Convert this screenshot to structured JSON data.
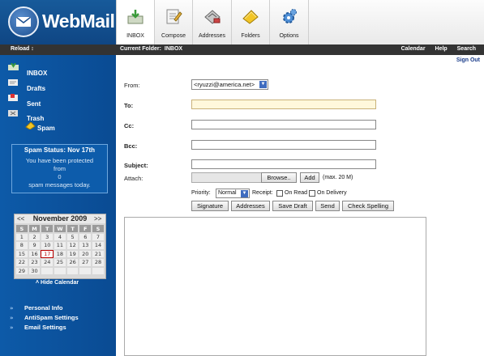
{
  "app": {
    "title": "WebMail"
  },
  "toolbar": {
    "items": [
      {
        "label": "INBOX",
        "icon": "inbox-icon"
      },
      {
        "label": "Compose",
        "icon": "compose-icon"
      },
      {
        "label": "Addresses",
        "icon": "addresses-icon"
      },
      {
        "label": "Folders",
        "icon": "folders-icon"
      },
      {
        "label": "Options",
        "icon": "options-icon"
      }
    ]
  },
  "band": {
    "reload": "Reload ↕",
    "current_folder_label": "Current Folder:",
    "current_folder": "INBOX",
    "nav": [
      "Calendar",
      "Help",
      "Search"
    ],
    "signout": "Sign Out"
  },
  "sidebar": {
    "folders": [
      {
        "label": "INBOX"
      },
      {
        "label": "Drafts"
      },
      {
        "label": "Sent"
      },
      {
        "label": "Trash"
      },
      {
        "label": "Spam"
      }
    ],
    "spam": {
      "title": "Spam Status: Nov 17th",
      "line1": "You have been protected",
      "line2": "from",
      "count": "0",
      "line3": "spam messages today."
    },
    "calendar": {
      "prev": "<<",
      "month": "November 2009",
      "next": ">>",
      "weekdays": [
        "S",
        "M",
        "T",
        "W",
        "T",
        "F",
        "S"
      ],
      "days": [
        "1",
        "2",
        "3",
        "4",
        "5",
        "6",
        "7",
        "8",
        "9",
        "10",
        "11",
        "12",
        "13",
        "14",
        "15",
        "16",
        "17",
        "18",
        "19",
        "20",
        "21",
        "22",
        "23",
        "24",
        "25",
        "26",
        "27",
        "28",
        "29",
        "30"
      ],
      "today": "17",
      "hide": "˄ Hide Calendar"
    },
    "links": [
      "Personal Info",
      "AntiSpam Settings",
      "Email Settings"
    ]
  },
  "compose": {
    "from_label": "From:",
    "from_value": "<ryuzzi@america.net>",
    "to_label": "To:",
    "cc_label": "Cc:",
    "bcc_label": "Bcc:",
    "subject_label": "Subject:",
    "attach_label": "Attach:",
    "browse": "Browse..",
    "add": "Add",
    "max": "(max. 20 M)",
    "priority_label": "Priority:",
    "priority_value": "Normal",
    "receipt_label": "Receipt:",
    "on_read": "On Read",
    "on_delivery": "On Delivery",
    "buttons": [
      "Signature",
      "Addresses",
      "Save Draft",
      "Send",
      "Check Spelling"
    ]
  },
  "colors": {
    "sidebar": "#0d5aa8",
    "band": "#333333",
    "to_field": "#fff8dc"
  }
}
